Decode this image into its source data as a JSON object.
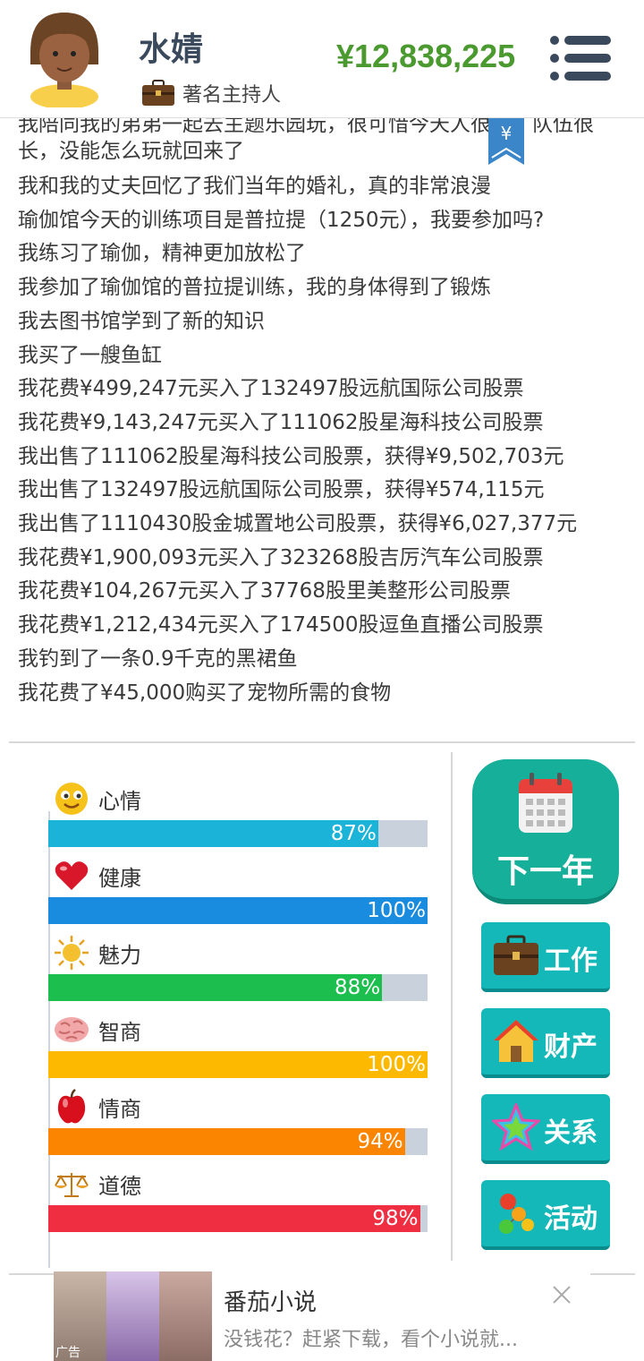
{
  "header": {
    "name": "水婧",
    "title": "著名主持人",
    "money": "¥12,838,225"
  },
  "log": {
    "lines": [
      "我陪同我的弟弟一起去主题乐园玩，很可惜今天人很多，队伍很长，没能怎么玩就回来了",
      "我和我的丈夫回忆了我们当年的婚礼，真的非常浪漫",
      "瑜伽馆今天的训练项目是普拉提（1250元），我要参加吗?",
      "我练习了瑜伽，精神更加放松了",
      "我参加了瑜伽馆的普拉提训练，我的身体得到了锻炼",
      "我去图书馆学到了新的知识",
      "我买了一艘鱼缸",
      "我花费¥499,247元买入了132497股远航国际公司股票",
      "我花费¥9,143,247元买入了111062股星海科技公司股票",
      "我出售了111062股星海科技公司股票，获得¥9,502,703元",
      "我出售了132497股远航国际公司股票，获得¥574,115元",
      "我出售了1110430股金城置地公司股票，获得¥6,027,377元",
      "我花费¥1,900,093元买入了323268股吉厉汽车公司股票",
      "我花费¥104,267元买入了37768股里美整形公司股票",
      "我花费¥1,212,434元买入了174500股逗鱼直播公司股票",
      "我钓到了一条0.9千克的黑裙鱼",
      "我花费了¥45,000购买了宠物所需的食物"
    ],
    "bookmark_symbol": "¥"
  },
  "stats": [
    {
      "label": "心情",
      "percent": 87,
      "value": "87%",
      "color": "#1bb3d8",
      "icon": "smiley-icon"
    },
    {
      "label": "健康",
      "percent": 100,
      "value": "100%",
      "color": "#1a8ce0",
      "icon": "heart-icon"
    },
    {
      "label": "魅力",
      "percent": 88,
      "value": "88%",
      "color": "#1cbf4e",
      "icon": "sun-icon"
    },
    {
      "label": "智商",
      "percent": 100,
      "value": "100%",
      "color": "#fdb900",
      "icon": "brain-icon"
    },
    {
      "label": "情商",
      "percent": 94,
      "value": "94%",
      "color": "#fb8500",
      "icon": "apple-icon"
    },
    {
      "label": "道德",
      "percent": 98,
      "value": "98%",
      "color": "#ef2f41",
      "icon": "scales-icon"
    }
  ],
  "buttons": {
    "next_year": "下一年",
    "work": "工作",
    "property": "财产",
    "relations": "关系",
    "activities": "活动"
  },
  "ad": {
    "title": "番茄小说",
    "desc": "没钱花？赶紧下载，看个小说就...",
    "tag": "广告"
  }
}
